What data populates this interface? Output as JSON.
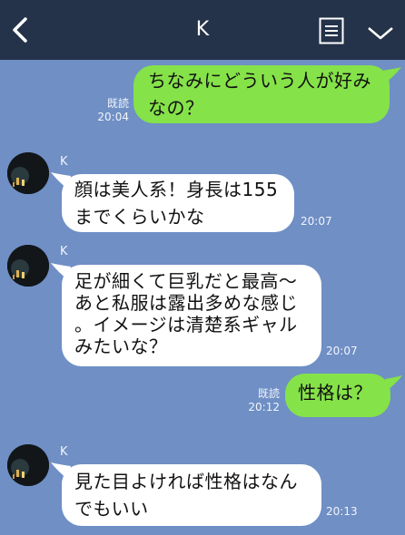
{
  "header": {
    "title": "K",
    "back_icon": "chevron-left-icon",
    "menu_icon": "list-icon",
    "more_icon": "chevron-down-icon"
  },
  "colors": {
    "background": "#6f8fc5",
    "header": "#243349",
    "my_bubble": "#85e249",
    "their_bubble": "#ffffff"
  },
  "messages": [
    {
      "from": "me",
      "lines": [
        "ちなみにどういう人が好み",
        "なの？"
      ],
      "read": "既読",
      "time": "20:04"
    },
    {
      "from": "K",
      "sender": "K",
      "lines": [
        "顔は美人系！身長は155",
        "までくらいかな"
      ],
      "time": "20:07"
    },
    {
      "from": "K",
      "sender": "K",
      "lines": [
        "足が細くて巨乳だと最高〜",
        "あと私服は露出多めな感じ",
        "。イメージは清楚系ギャル",
        "みたいな？"
      ],
      "time": "20:07"
    },
    {
      "from": "me",
      "lines": [
        "性格は？"
      ],
      "read": "既読",
      "time": "20:12"
    },
    {
      "from": "K",
      "sender": "K",
      "lines": [
        "見た目よければ性格はなん",
        "でもいい"
      ],
      "time": "20:13"
    }
  ]
}
